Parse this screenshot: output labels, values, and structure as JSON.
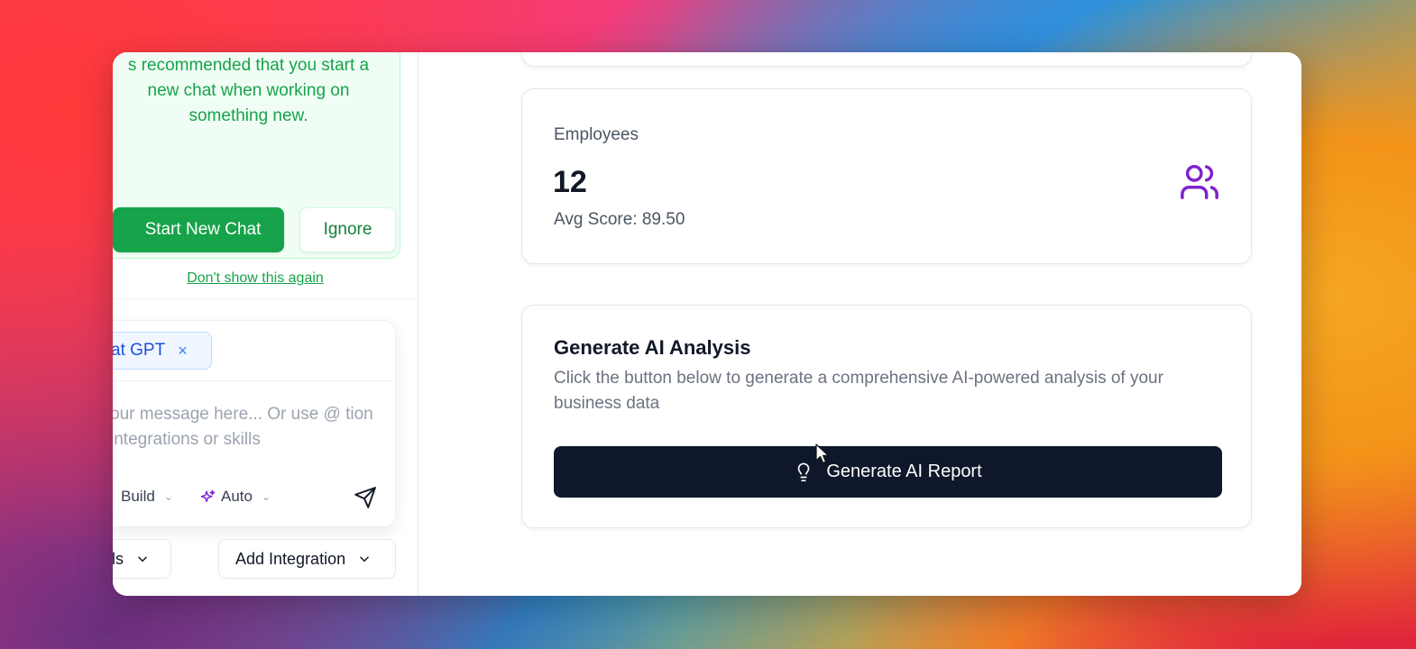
{
  "notice": {
    "text": "s recommended that you start a new chat when working on something new.",
    "start_label": "Start New Chat",
    "ignore_label": "Ignore",
    "dont_show_label": "Don't show this again"
  },
  "composer": {
    "chip_label": "at GPT",
    "chip_close": "×",
    "placeholder": "our message here... Or use @ tion integrations or skills",
    "mode_label": "Build",
    "model_label": "Auto"
  },
  "dropdowns": {
    "skills_label": "ls",
    "integration_label": "Add Integration"
  },
  "employees": {
    "label": "Employees",
    "value": "12",
    "avg": "Avg Score: 89.50"
  },
  "ai": {
    "title": "Generate AI Analysis",
    "description": "Click the button below to generate a comprehensive AI-powered analysis of your business data",
    "button_label": "Generate AI Report"
  },
  "colors": {
    "accent_green": "#16a34a",
    "dark_button": "#0f172a",
    "users_icon": "#7e22ce"
  }
}
